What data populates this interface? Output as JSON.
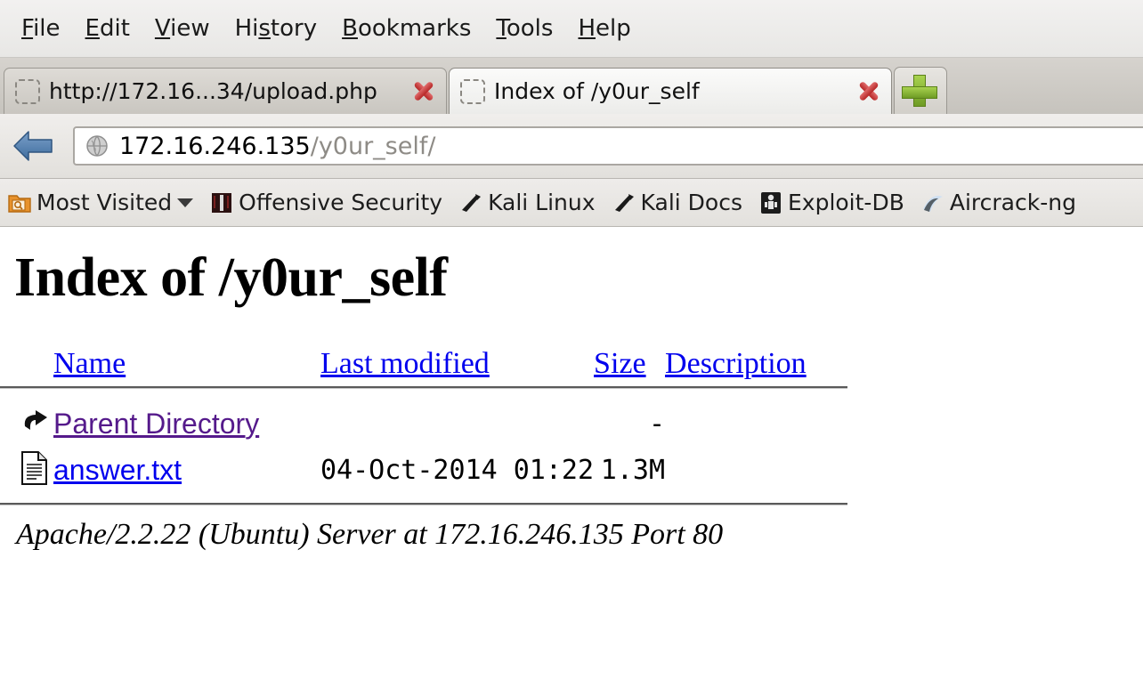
{
  "menubar": {
    "items": [
      {
        "label": "File",
        "accel": "F"
      },
      {
        "label": "Edit",
        "accel": "E"
      },
      {
        "label": "View",
        "accel": "V"
      },
      {
        "label": "History",
        "accel": "s"
      },
      {
        "label": "Bookmarks",
        "accel": "B"
      },
      {
        "label": "Tools",
        "accel": "T"
      },
      {
        "label": "Help",
        "accel": "H"
      }
    ]
  },
  "tabs": {
    "items": [
      {
        "title": "http://172.16...34/upload.php",
        "active": false,
        "favicon": "missing-favicon"
      },
      {
        "title": "Index of /y0ur_self",
        "active": true,
        "favicon": "missing-favicon"
      }
    ],
    "new_tab_icon": "plus-icon",
    "close_icon": "close-icon"
  },
  "navbar": {
    "back_icon": "back-arrow-icon",
    "site_icon": "globe-icon",
    "url_host": "172.16.246.135",
    "url_path": "/y0ur_self/"
  },
  "bookmarks": {
    "items": [
      {
        "label": "Most Visited",
        "icon": "bookmark-folder-icon",
        "has_chevron": true
      },
      {
        "label": "Offensive Security",
        "icon": "offensive-security-icon",
        "has_chevron": false
      },
      {
        "label": "Kali Linux",
        "icon": "kali-dragon-icon",
        "has_chevron": false
      },
      {
        "label": "Kali Docs",
        "icon": "kali-dragon-icon",
        "has_chevron": false
      },
      {
        "label": "Exploit-DB",
        "icon": "exploit-db-icon",
        "has_chevron": false
      },
      {
        "label": "Aircrack-ng",
        "icon": "aircrack-icon",
        "has_chevron": false
      }
    ]
  },
  "page": {
    "title": "Index of /y0ur_self",
    "columns": [
      {
        "label": "Name"
      },
      {
        "label": "Last modified"
      },
      {
        "label": "Size"
      },
      {
        "label": "Description"
      }
    ],
    "rows": [
      {
        "icon": "parent-directory-icon",
        "name": "Parent Directory",
        "link_state": "visited",
        "modified": "",
        "size": "-",
        "description": ""
      },
      {
        "icon": "text-file-icon",
        "name": "answer.txt",
        "link_state": "unvisited",
        "modified": "04-Oct-2014 01:22",
        "size": "1.3M",
        "description": ""
      }
    ],
    "footer": "Apache/2.2.22 (Ubuntu) Server at 172.16.246.135 Port 80"
  },
  "colors": {
    "link_unvisited": "#0000EE",
    "link_visited": "#551A8B",
    "chrome_bg": "#E8E7E5",
    "page_bg": "#FFFFFF"
  }
}
